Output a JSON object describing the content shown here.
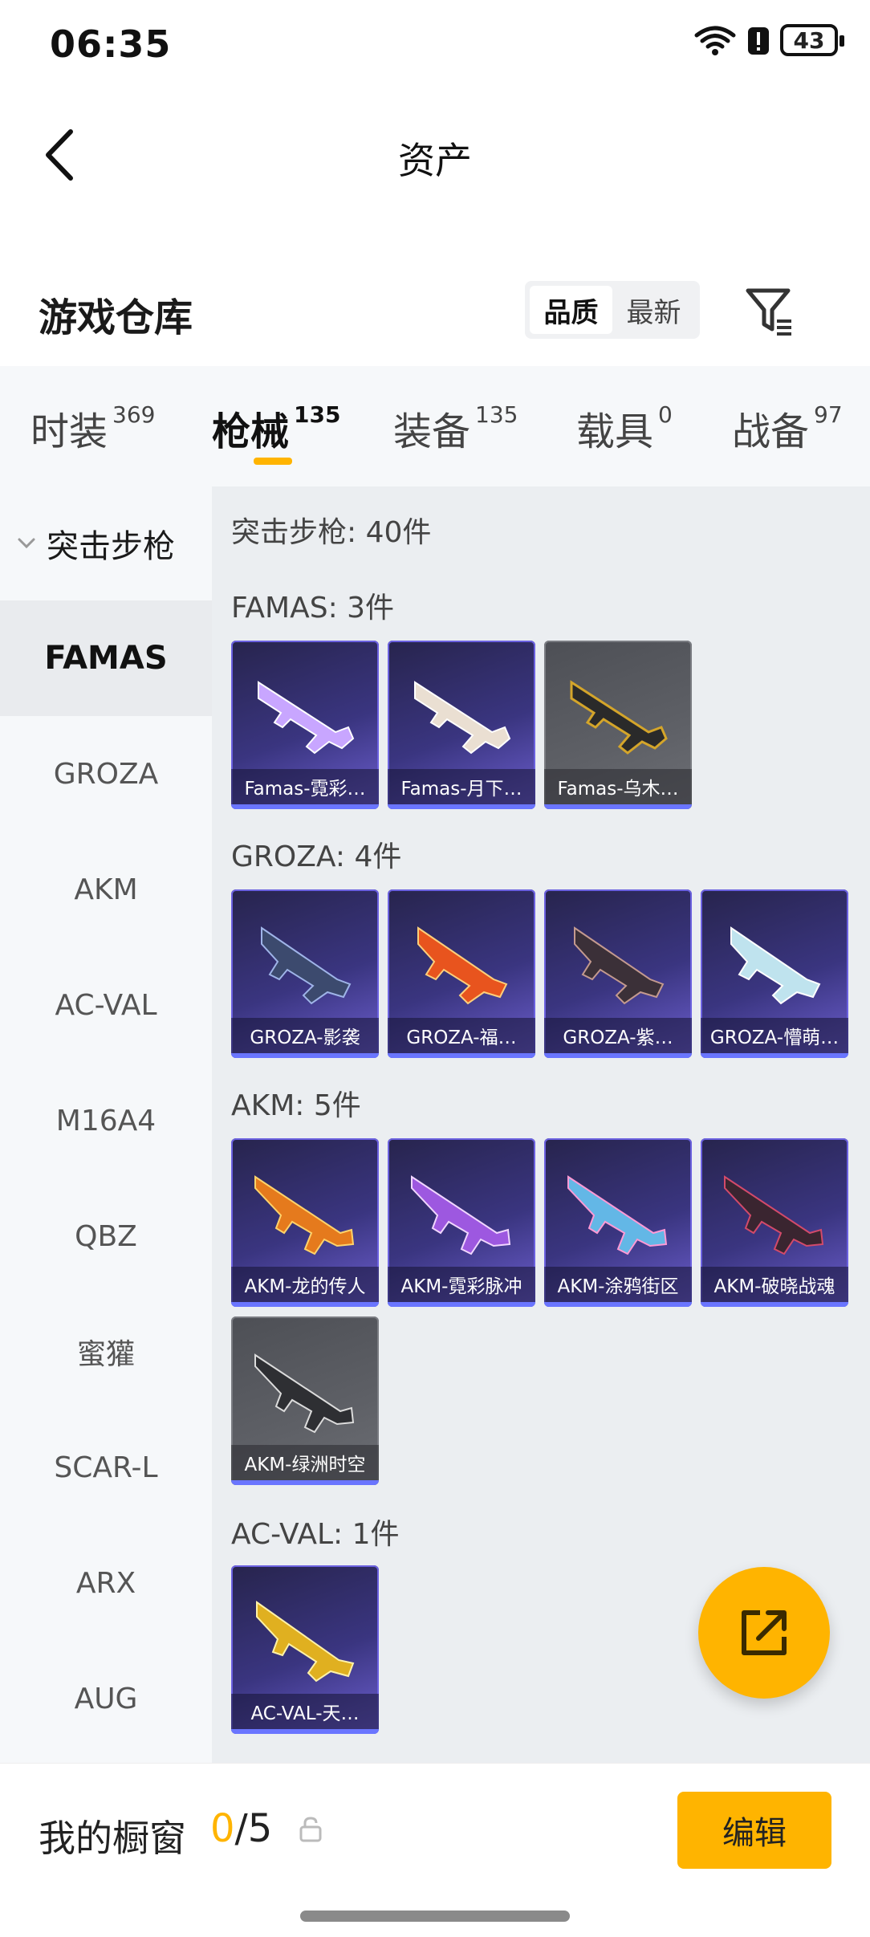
{
  "status": {
    "time": "06:35",
    "battery": "43"
  },
  "header": {
    "title": "资产"
  },
  "warehouse": {
    "title": "游戏仓库",
    "sort_options": [
      "品质",
      "最新"
    ]
  },
  "tabs": [
    {
      "label": "时装",
      "count": "369"
    },
    {
      "label": "枪械",
      "count": "135"
    },
    {
      "label": "装备",
      "count": "135"
    },
    {
      "label": "载具",
      "count": "0"
    },
    {
      "label": "战备",
      "count": "97"
    }
  ],
  "sidebar": {
    "category": "突击步枪",
    "items": [
      "FAMAS",
      "GROZA",
      "AKM",
      "AC-VAL",
      "M16A4",
      "QBZ",
      "蜜獾",
      "SCAR-L",
      "ARX",
      "AUG"
    ]
  },
  "content": {
    "summary": "突击步枪: 40件",
    "groups": [
      {
        "label": "FAMAS: 3件",
        "items": [
          "Famas-霓彩…",
          "Famas-月下…",
          "Famas-乌木…"
        ]
      },
      {
        "label": "GROZA: 4件",
        "items": [
          "GROZA-影袭",
          "GROZA-福…",
          "GROZA-紫…",
          "GROZA-懵萌…"
        ]
      },
      {
        "label": "AKM: 5件",
        "items": [
          "AKM-龙的传人",
          "AKM-霓彩脉冲",
          "AKM-涂鸦街区",
          "AKM-破晓战魂",
          "AKM-绿洲时空"
        ]
      },
      {
        "label": "AC-VAL: 1件",
        "items": [
          "AC-VAL-天…"
        ]
      }
    ]
  },
  "bottom": {
    "showcase_label": "我的橱窗",
    "showcase_current": "0",
    "showcase_total": "/5",
    "edit_label": "编辑"
  },
  "colors": {
    "accent": "#ffb400",
    "card_purple": "#3a3580",
    "card_grey": "#5e6066"
  }
}
